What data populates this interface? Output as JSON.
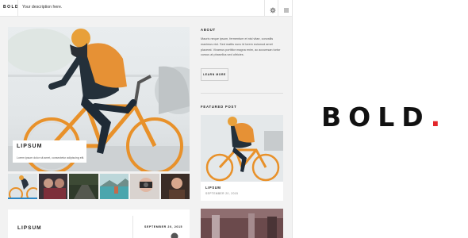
{
  "topbar": {
    "logo": "BOLD",
    "description": "Your description here.",
    "icons": [
      "gear-icon",
      "menu-icon"
    ]
  },
  "hero": {
    "title": "LIPSUM",
    "subtitle": "Lorem ipsum dolor sit amet, consectetur adipiscing elit."
  },
  "thumbnails": [
    {
      "name": "cyclist",
      "active": true
    },
    {
      "name": "people"
    },
    {
      "name": "road"
    },
    {
      "name": "lake"
    },
    {
      "name": "camera"
    },
    {
      "name": "portrait"
    }
  ],
  "post2": {
    "title": "LIPSUM",
    "date": "SEPTEMBER 20, 2015"
  },
  "sidebar": {
    "about_heading": "ABOUT",
    "about_text": "Mauris neque ipsum, fermentum et nisl vitae, convallis maximus nisl. Sed mattis nunc id lorem euismod amet placerat. Vivamus porttitor magna enim, ac accumsan tortor cursus at phasellus sed ultricies.",
    "learn_more": "LEARN MORE",
    "featured_heading": "FEATURED POST",
    "featured_title": "LIPSUM",
    "featured_date": "SEPTEMBER 20, 2015"
  },
  "brand": {
    "word": "BOLD",
    "dot": ".",
    "dot_color": "#e3262b"
  }
}
